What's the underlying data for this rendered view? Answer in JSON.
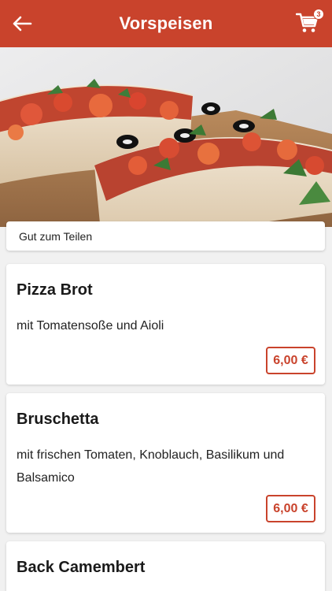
{
  "header": {
    "title": "Vorspeisen",
    "cart_count": "3"
  },
  "section": {
    "label": "Gut zum Teilen"
  },
  "items": [
    {
      "name": "Pizza Brot",
      "description": "mit Tomatensoße und Aioli",
      "price": "6,00 €"
    },
    {
      "name": "Bruschetta",
      "description": "mit frischen Tomaten, Knoblauch, Basilikum und Balsamico",
      "price": "6,00 €"
    },
    {
      "name": "Back Camembert"
    }
  ],
  "colors": {
    "accent": "#c9432c",
    "background": "#f1f1f1"
  },
  "icons": {
    "back": "arrow-left-icon",
    "cart": "shopping-cart-icon"
  }
}
